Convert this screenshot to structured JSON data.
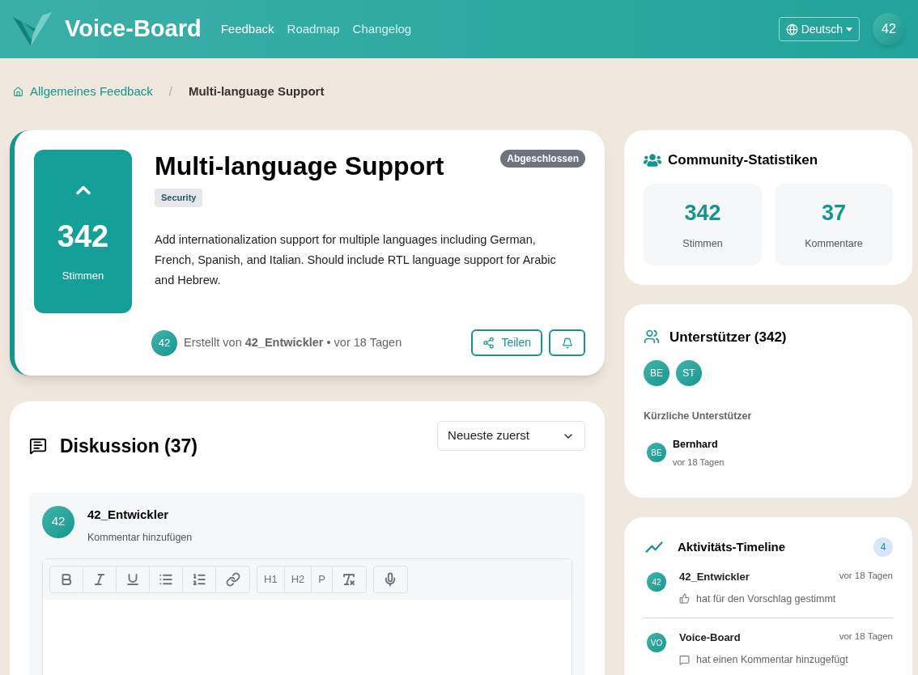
{
  "header": {
    "brand": "Voice-Board",
    "nav": [
      {
        "label": "Feedback",
        "selected": true
      },
      {
        "label": "Roadmap",
        "selected": false
      },
      {
        "label": "Changelog",
        "selected": false
      }
    ],
    "language": "Deutsch",
    "user_avatar": "42"
  },
  "breadcrumb": {
    "parent": "Allgemeines Feedback",
    "separator": "/",
    "current": "Multi-language Support"
  },
  "post": {
    "votes": "342",
    "votes_label": "Stimmen",
    "title": "Multi-language Support",
    "status": "Abgeschlossen",
    "tag": "Security",
    "description": "Add internationalization support for multiple languages including German, French, Spanish, and Italian. Should include RTL language support for Arabic and Hebrew.",
    "author_avatar": "42",
    "meta": "Erstellt von **42_Entwickler** • vor 18 Tagen",
    "share": "Teilen"
  },
  "discussion": {
    "title": "Diskussion (37)",
    "sort": "Neueste zuerst",
    "composer": {
      "avatar": "42",
      "name": "42_Entwickler",
      "hint": "Kommentar hinzufügen",
      "toolbar": [
        {
          "buttons": [
            {
              "kind": "bold"
            },
            {
              "kind": "italic"
            },
            {
              "kind": "underline"
            },
            {
              "kind": "bullets"
            },
            {
              "kind": "numbers"
            },
            {
              "kind": "link"
            }
          ]
        },
        {
          "buttons": [
            {
              "kind": "text",
              "label": "H1"
            },
            {
              "kind": "text",
              "label": "H2"
            },
            {
              "kind": "text",
              "label": "P"
            },
            {
              "kind": "clear"
            }
          ]
        },
        {
          "buttons": [
            {
              "kind": "mic"
            }
          ]
        }
      ]
    }
  },
  "stats": {
    "title": "Community-Statistiken",
    "items": [
      {
        "value": "342",
        "label": "Stimmen"
      },
      {
        "value": "37",
        "label": "Kommentare"
      }
    ]
  },
  "supporters": {
    "title": "Unterstützer (342)",
    "avatars": [
      "BE",
      "ST"
    ],
    "recent_title": "Kürzliche Unterstützer",
    "recent": [
      {
        "avatar": "BE",
        "name": "Bernhard",
        "time": "vor 18 Tagen"
      }
    ]
  },
  "timeline": {
    "title": "Aktivitäts-Timeline",
    "count": "4",
    "items": [
      {
        "kind": "vote",
        "avatar": "42",
        "name": "42_Entwickler",
        "time": "vor 18 Tagen",
        "text": "hat für den Vorschlag gestimmt"
      },
      {
        "kind": "comment",
        "avatar": "VO",
        "name": "Voice-Board",
        "time": "vor 18 Tagen",
        "text": "hat einen Kommentar hinzugefügt"
      }
    ]
  }
}
